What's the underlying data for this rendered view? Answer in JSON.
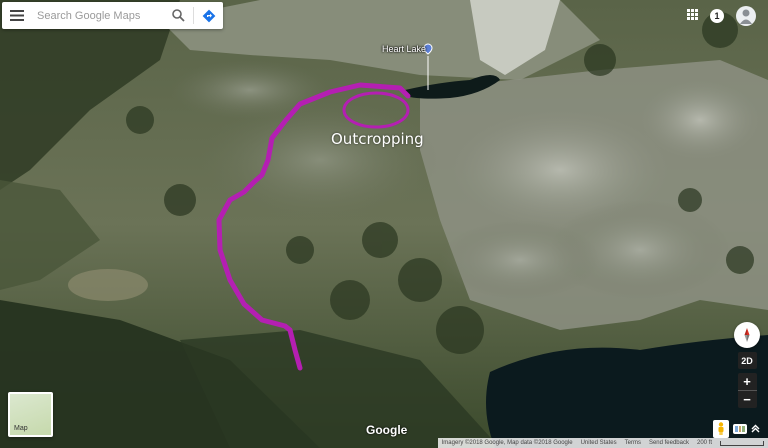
{
  "search": {
    "placeholder": "Search Google Maps"
  },
  "icons": {
    "menu": "menu-icon",
    "search": "search-icon",
    "directions": "directions-icon",
    "apps": "apps-grid-icon",
    "account": "avatar-icon",
    "compass": "compass-icon",
    "pegman": "pegman-icon",
    "expand": "expand-icon"
  },
  "header": {
    "notification_count": "1"
  },
  "map": {
    "place_label": "Heart Lake",
    "annotation_text": "Outcropping",
    "brand": "Google",
    "layer_label": "Map"
  },
  "controls": {
    "view_mode": "2D",
    "zoom_in": "+",
    "zoom_out": "−"
  },
  "footer": {
    "attribution": "Imagery ©2018 Google, Map data ©2018 Google",
    "country": "United States",
    "terms": "Terms",
    "feedback": "Send feedback",
    "scale": "200 ft"
  },
  "colors": {
    "trail": "#b41fb2",
    "directions": "#1a73e8",
    "lake": "#0b1a1e"
  }
}
